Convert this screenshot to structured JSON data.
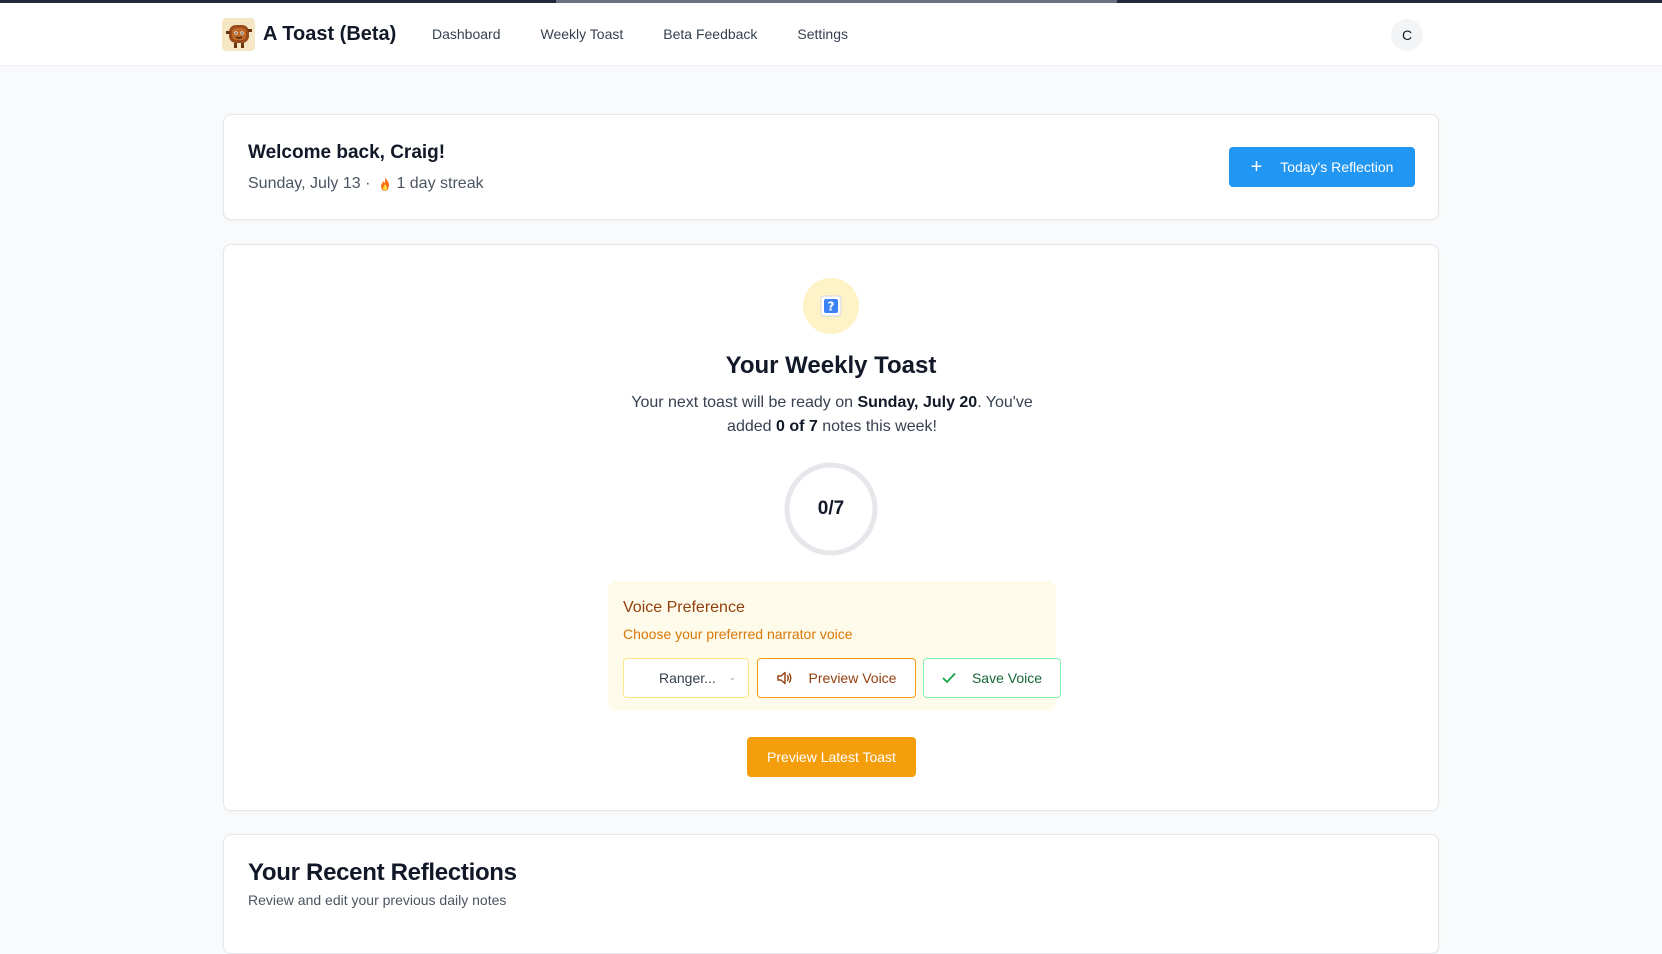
{
  "app": {
    "title": "A Toast (Beta)",
    "logo_icon": "toast-character-icon"
  },
  "nav": {
    "items": [
      {
        "label": "Dashboard"
      },
      {
        "label": "Weekly Toast"
      },
      {
        "label": "Beta Feedback"
      },
      {
        "label": "Settings"
      }
    ]
  },
  "user": {
    "avatar_initial": "C"
  },
  "welcome": {
    "heading": "Welcome back, Craig!",
    "date": "Sunday, July 13 ·",
    "streak": "1 day streak",
    "streak_icon": "fire-icon",
    "cta_label": "Today's Reflection",
    "cta_icon": "plus-icon"
  },
  "weekly_toast": {
    "icon": "question-box-icon",
    "title": "Your Weekly Toast",
    "desc_part1": "Your next toast will be ready on ",
    "ready_date": "Sunday, July 20",
    "desc_part2": ". You've added ",
    "notes_count": "0 of 7",
    "desc_part3": " notes this week!",
    "progress_label": "0/7",
    "progress_value": 0,
    "progress_total": 7,
    "voice": {
      "title": "Voice Preference",
      "subtitle": "Choose your preferred narrator voice",
      "selected": "Ranger...",
      "preview_label": "Preview Voice",
      "save_label": "Save Voice"
    },
    "preview_toast_label": "Preview Latest Toast"
  },
  "recent": {
    "title": "Your Recent Reflections",
    "subtitle": "Review and edit your previous daily notes"
  },
  "colors": {
    "primary": "#2196f3",
    "accent": "#f59e0b",
    "voice_bg": "#fffbeb",
    "success": "#16a34a"
  }
}
